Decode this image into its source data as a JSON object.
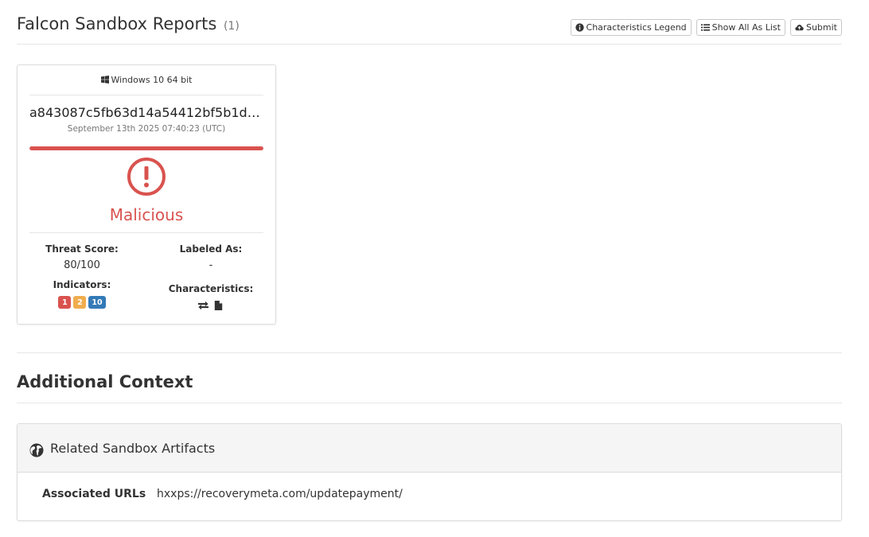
{
  "header": {
    "title": "Falcon Sandbox Reports",
    "count": "(1)",
    "buttons": {
      "legend": "Characteristics Legend",
      "list": "Show All As List",
      "submit": "Submit"
    }
  },
  "report": {
    "os": "Windows 10 64 bit",
    "hash": "a843087c5fb63d14a54412bf5b1d5...",
    "date": "September 13th 2025 07:40:23 (UTC)",
    "verdict": "Malicious",
    "threat_score_label": "Threat Score:",
    "threat_score": "80/100",
    "threat_fraction": 1.0,
    "labeled_as_label": "Labeled As:",
    "labeled_as": "-",
    "indicators_label": "Indicators:",
    "indicators": [
      {
        "value": "1",
        "color": "#d9534f"
      },
      {
        "value": "2",
        "color": "#f0ad4e"
      },
      {
        "value": "10",
        "color": "#337ab7"
      }
    ],
    "characteristics_label": "Characteristics:",
    "characteristics_icons": [
      "exchange-icon",
      "file-icon"
    ],
    "malicious_color": "#d9534f"
  },
  "additional": {
    "title": "Additional Context",
    "panel_title": "Related Sandbox Artifacts",
    "associated_urls_label": "Associated URLs",
    "associated_urls_value": "hxxps://recoverymeta.com/updatepayment/"
  }
}
